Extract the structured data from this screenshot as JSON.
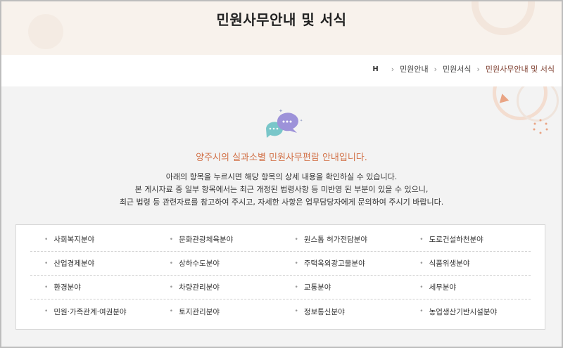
{
  "header": {
    "title": "민원사무안내 및 서식"
  },
  "breadcrumb": {
    "home": "H",
    "items": [
      "민원안내",
      "민원서식",
      "민원사무안내 및 서식"
    ]
  },
  "intro": {
    "subtitle": "양주시의 실과소별 민원사무편람 안내입니다.",
    "lines": [
      "아래의 항목을 누르시면 해당 항목의 상세 내용을 확인하실 수 있습니다.",
      "본 게시자료 중 일부 항목에서는 최근 개정된 법령사항 등 미반영 된 부분이 있을 수 있으니,",
      "최근 법령 등 관련자료를 참고하여 주시고, 자세한 사항은 업무담당자에게 문의하여 주시기 바랍니다."
    ]
  },
  "categories": [
    [
      "사회복지분야",
      "문화관광체육분야",
      "원스톱 허가전담분야",
      "도로건설하천분야"
    ],
    [
      "산업경제분야",
      "상하수도분야",
      "주택옥외광고물분야",
      "식품위생분야"
    ],
    [
      "환경분야",
      "차량관리분야",
      "교통분야",
      "세무분야"
    ],
    [
      "민원·가족관계·여권분야",
      "토지관리분야",
      "정보통신분야",
      "농업생산기반시설분야"
    ]
  ],
  "colors": {
    "accent": "#d2734a",
    "banner_bg": "#f8f2ec",
    "content_bg": "#f3f3f3"
  },
  "icons": {
    "chat": "chat-bubbles-icon",
    "home": "home-icon"
  }
}
